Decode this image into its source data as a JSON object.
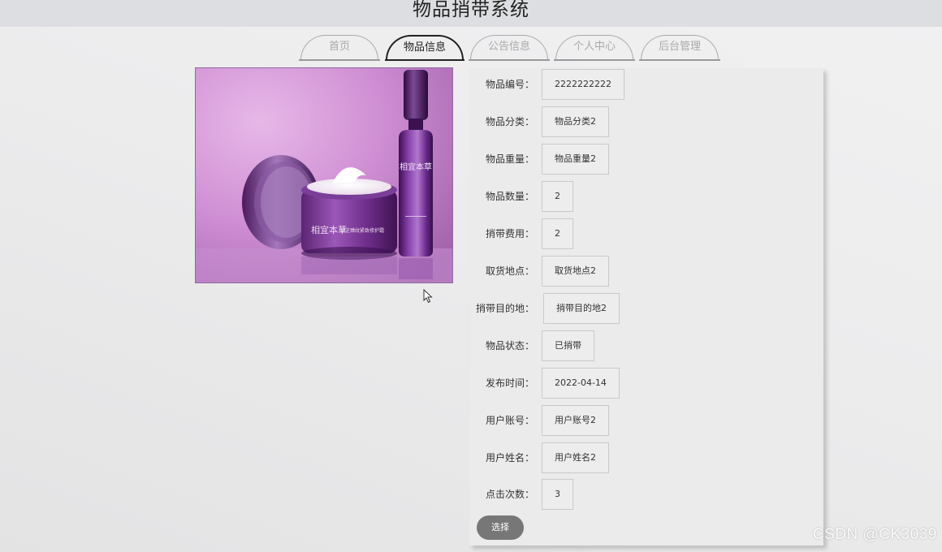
{
  "header": {
    "title": "物品捎带系统"
  },
  "nav": {
    "tabs": [
      {
        "label": "首页"
      },
      {
        "label": "物品信息"
      },
      {
        "label": "公告信息"
      },
      {
        "label": "个人中心"
      },
      {
        "label": "后台管理"
      }
    ],
    "active_tab": "物品信息"
  },
  "product_image": {
    "brand_text": "相宜本草",
    "product_text": "紫芝臻纹紧致修护霜"
  },
  "details": [
    {
      "label": "物品编号：",
      "value": "2222222222"
    },
    {
      "label": "物品分类：",
      "value": "物品分类2"
    },
    {
      "label": "物品重量：",
      "value": "物品重量2"
    },
    {
      "label": "物品数量：",
      "value": "2"
    },
    {
      "label": "捎带费用：",
      "value": "2"
    },
    {
      "label": "取货地点：",
      "value": "取货地点2"
    },
    {
      "label": "捎带目的地：",
      "value": "捎带目的地2"
    },
    {
      "label": "物品状态：",
      "value": "已捎带"
    },
    {
      "label": "发布时间：",
      "value": "2022-04-14"
    },
    {
      "label": "用户账号：",
      "value": "用户账号2"
    },
    {
      "label": "用户姓名：",
      "value": "用户姓名2"
    },
    {
      "label": "点击次数：",
      "value": "3"
    }
  ],
  "actions": {
    "select_label": "选择"
  },
  "watermark": "CSDN @CK3039",
  "colors": {
    "header_bg": "#dddee1",
    "page_bg": "#ececed",
    "button_bg": "#777777",
    "product_purple": "#6b2f8a"
  }
}
